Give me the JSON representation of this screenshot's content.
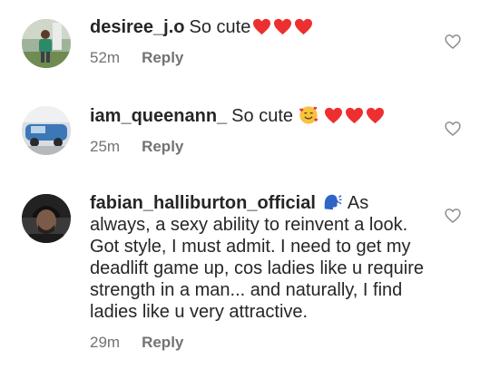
{
  "comments": [
    {
      "username": "desiree_j.o",
      "text": "So cute",
      "emojis": [
        "red-heart",
        "red-heart",
        "red-heart"
      ],
      "time": "52m",
      "reply_label": "Reply"
    },
    {
      "username": "iam_queenann_",
      "text": "So cute",
      "emojis": [
        "smiling-face-with-hearts",
        "red-heart",
        "red-heart",
        "red-heart"
      ],
      "time": "25m",
      "reply_label": "Reply"
    },
    {
      "username": "fabian_halliburton_official",
      "emojis": [
        "speaking-head"
      ],
      "text": "As always, a sexy ability to reinvent a look. Got style, I must admit. I need to get my deadlift game up, cos ladies like u require strength in a man... and naturally, I find ladies like u very attractive.",
      "time": "29m",
      "reply_label": "Reply"
    }
  ],
  "icons": {
    "like": "heart-outline-icon"
  },
  "colors": {
    "text": "#262626",
    "meta": "#737373",
    "heart": "#ed2f2f"
  }
}
